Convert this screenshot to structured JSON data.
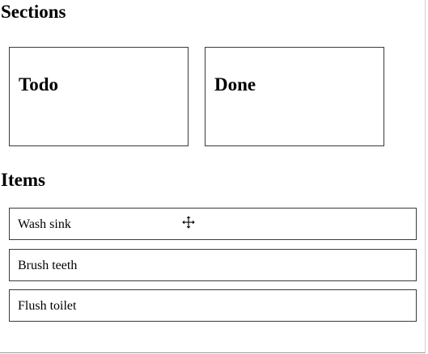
{
  "sections_heading": "Sections",
  "sections": [
    {
      "label": "Todo"
    },
    {
      "label": "Done"
    }
  ],
  "items_heading": "Items",
  "items": [
    {
      "label": "Wash sink"
    },
    {
      "label": "Brush teeth"
    },
    {
      "label": "Flush toilet"
    }
  ],
  "cursor": {
    "icon": "move-cursor-icon"
  }
}
